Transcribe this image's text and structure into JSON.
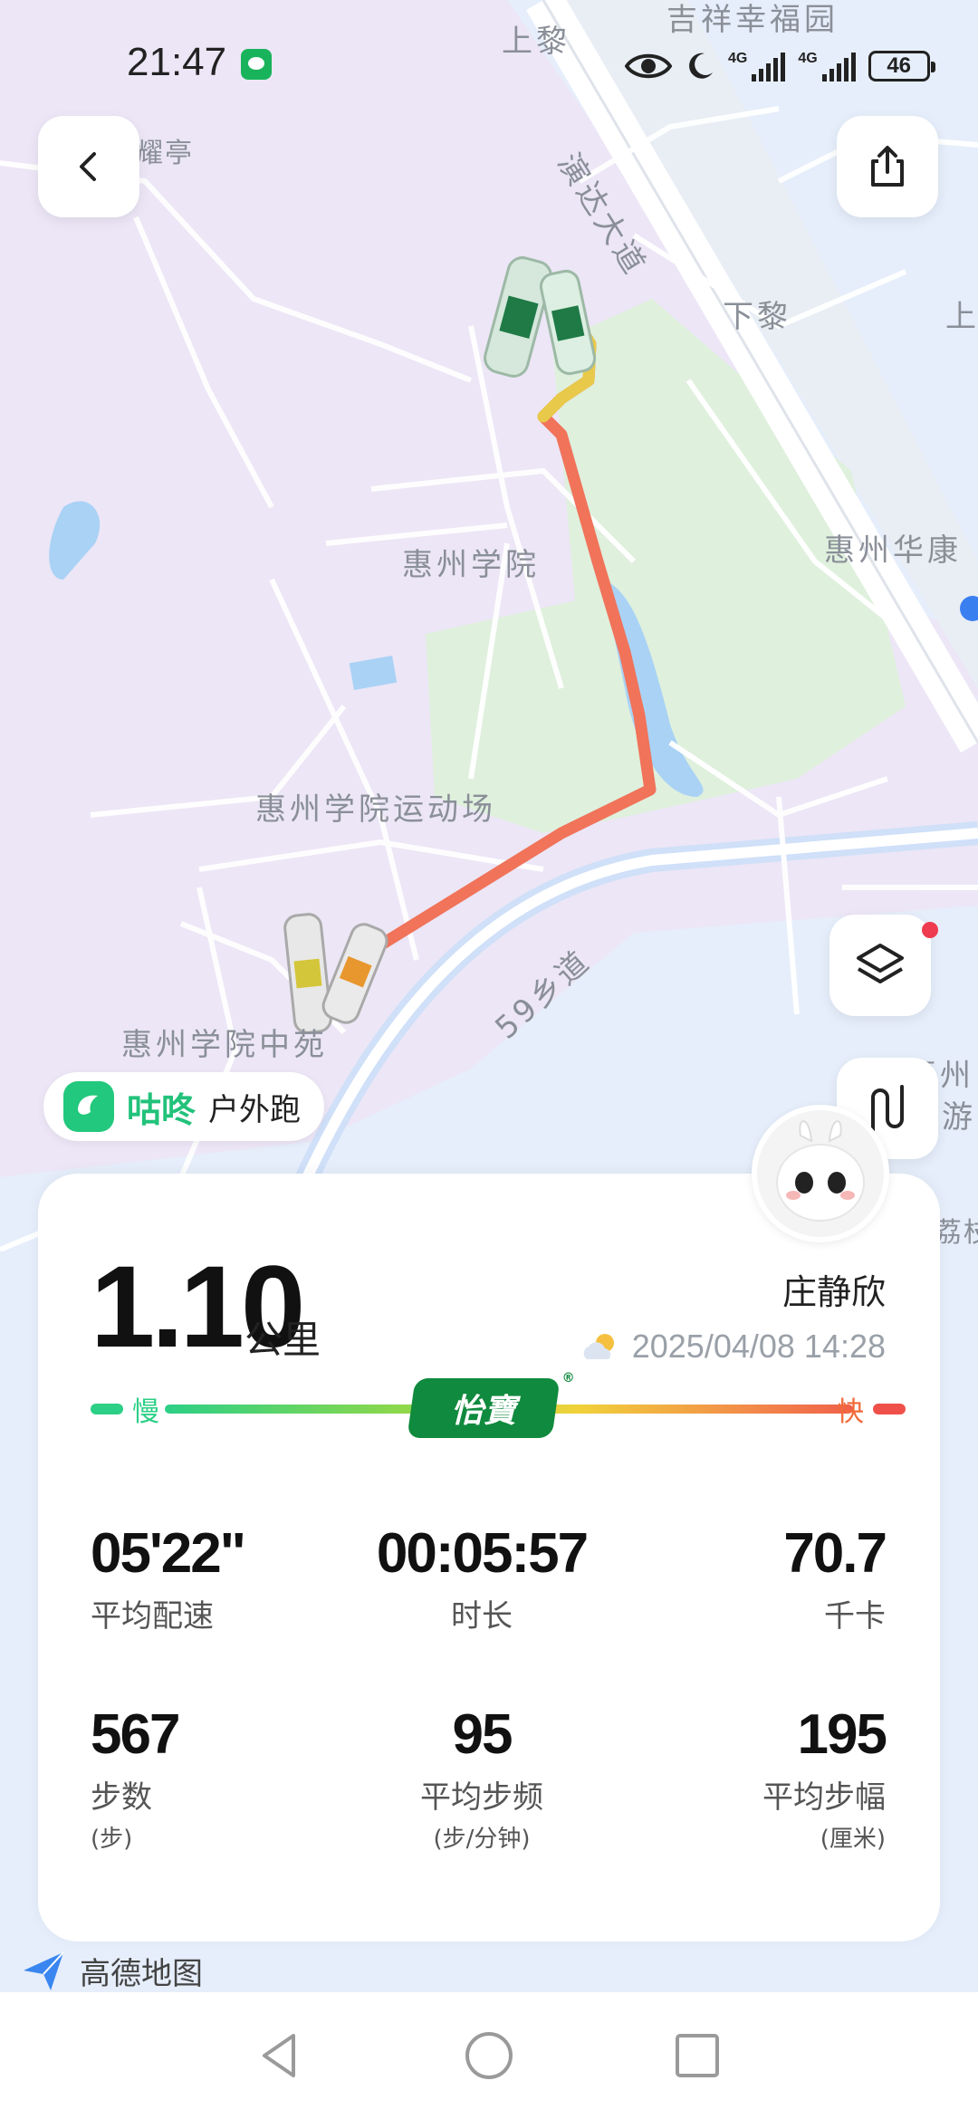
{
  "status_bar": {
    "time": "21:47",
    "network_1": "4G",
    "network_2": "4G",
    "battery": "46"
  },
  "map": {
    "labels": {
      "shangli_top": "上黎",
      "jixiang": "吉祥幸福园",
      "yaoting": "耀亭",
      "yanda": "演达大道",
      "xiali": "下黎",
      "shang_right": "上",
      "huizhou_xueyuan": "惠州学院",
      "huizhou_huakang": "惠州华康",
      "stadium": "惠州学院运动场",
      "road_59": "59乡道",
      "zhongyuan": "惠州学院中苑",
      "huizhou_you": "惠州",
      "you_char": "游",
      "lizhi": "荔枝"
    },
    "route_color": "#f0735a"
  },
  "brand": {
    "name": "咕咚",
    "mode": "户外跑"
  },
  "workout": {
    "distance": "1.10",
    "distance_unit": "公里",
    "user_name": "庄静欣",
    "datetime": "2025/04/08 14:28",
    "pace_slow": "慢",
    "pace_fast": "快",
    "sponsor": "怡寶",
    "stats": {
      "avg_pace": {
        "value": "05'22\"",
        "label": "平均配速"
      },
      "duration": {
        "value": "00:05:57",
        "label": "时长"
      },
      "calories": {
        "value": "70.7",
        "label": "千卡"
      },
      "steps": {
        "value": "567",
        "label": "步数",
        "unit": "(步)"
      },
      "cadence": {
        "value": "95",
        "label": "平均步频",
        "unit": "(步/分钟)"
      },
      "stride": {
        "value": "195",
        "label": "平均步幅",
        "unit": "(厘米)"
      }
    }
  },
  "map_provider": "高德地图",
  "icons": {
    "back": "chevron-left-icon",
    "share": "share-icon",
    "layers": "layers-icon",
    "route": "route-icon",
    "weather": "partly-cloudy-icon"
  }
}
